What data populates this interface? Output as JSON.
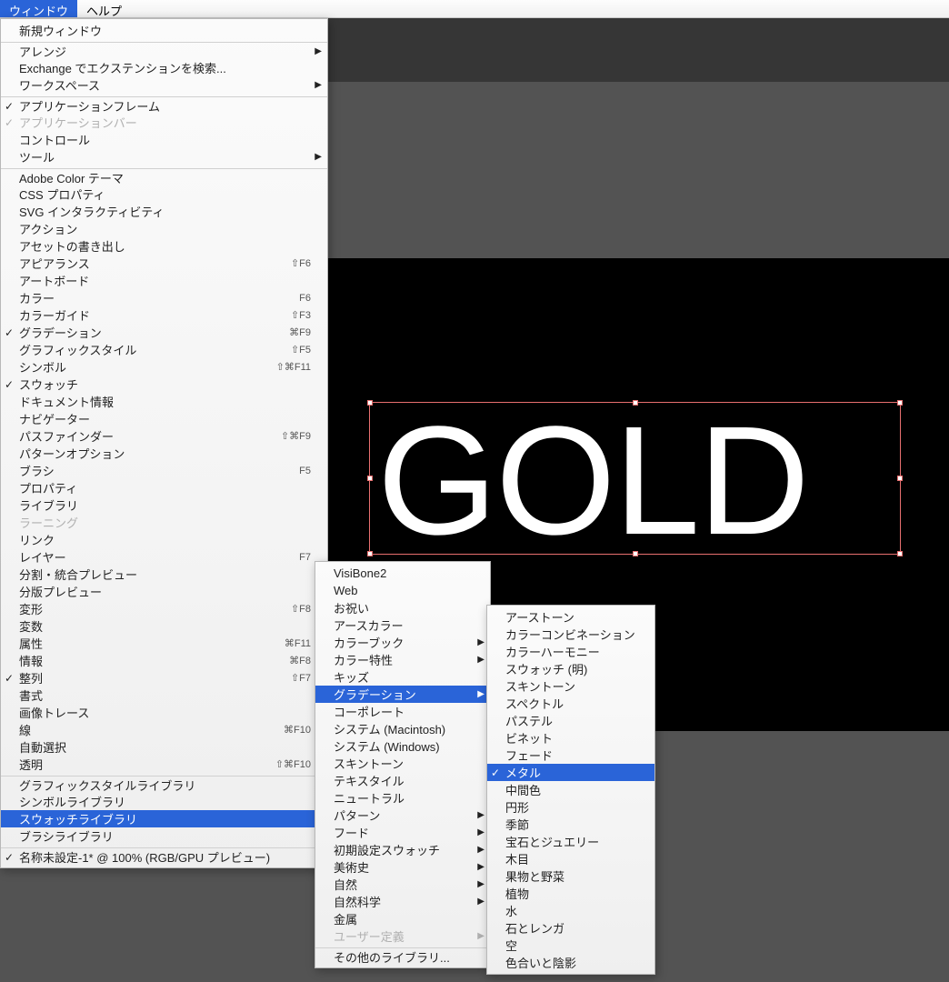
{
  "menubar": {
    "window": "ウィンドウ",
    "help": "ヘルプ"
  },
  "canvas": {
    "text": "GOLD"
  },
  "menu1": [
    {
      "t": "新規ウィンドウ"
    },
    {
      "t": "アレンジ",
      "sep": true,
      "sub": true
    },
    {
      "t": "Exchange でエクステンションを検索..."
    },
    {
      "t": "ワークスペース",
      "sub": true
    },
    {
      "t": "アプリケーションフレーム",
      "sep": true,
      "chk": true
    },
    {
      "t": "アプリケーションバー",
      "chk": true,
      "dis": true
    },
    {
      "t": "コントロール"
    },
    {
      "t": "ツール",
      "sub": true
    },
    {
      "t": "Adobe Color テーマ",
      "sep": true
    },
    {
      "t": "CSS プロパティ"
    },
    {
      "t": "SVG インタラクティビティ"
    },
    {
      "t": "アクション"
    },
    {
      "t": "アセットの書き出し"
    },
    {
      "t": "アピアランス",
      "sc": "⇧F6"
    },
    {
      "t": "アートボード"
    },
    {
      "t": "カラー",
      "sc": "F6"
    },
    {
      "t": "カラーガイド",
      "sc": "⇧F3"
    },
    {
      "t": "グラデーション",
      "chk": true,
      "sc": "⌘F9"
    },
    {
      "t": "グラフィックスタイル",
      "sc": "⇧F5"
    },
    {
      "t": "シンボル",
      "sc": "⇧⌘F11"
    },
    {
      "t": "スウォッチ",
      "chk": true
    },
    {
      "t": "ドキュメント情報"
    },
    {
      "t": "ナビゲーター"
    },
    {
      "t": "パスファインダー",
      "sc": "⇧⌘F9"
    },
    {
      "t": "パターンオプション"
    },
    {
      "t": "ブラシ",
      "sc": "F5"
    },
    {
      "t": "プロパティ"
    },
    {
      "t": "ライブラリ"
    },
    {
      "t": "ラーニング",
      "dis": true
    },
    {
      "t": "リンク"
    },
    {
      "t": "レイヤー",
      "sc": "F7"
    },
    {
      "t": "分割・統合プレビュー"
    },
    {
      "t": "分版プレビュー"
    },
    {
      "t": "変形",
      "sc": "⇧F8"
    },
    {
      "t": "変数"
    },
    {
      "t": "属性",
      "sc": "⌘F11"
    },
    {
      "t": "情報",
      "sc": "⌘F8"
    },
    {
      "t": "整列",
      "chk": true,
      "sc": "⇧F7"
    },
    {
      "t": "書式",
      "sub": true
    },
    {
      "t": "画像トレース"
    },
    {
      "t": "線",
      "sc": "⌘F10"
    },
    {
      "t": "自動選択"
    },
    {
      "t": "透明",
      "sc": "⇧⌘F10"
    },
    {
      "t": "グラフィックスタイルライブラリ",
      "sep": true,
      "sub": true
    },
    {
      "t": "シンボルライブラリ",
      "sub": true
    },
    {
      "t": "スウォッチライブラリ",
      "sub": true,
      "hl": true
    },
    {
      "t": "ブラシライブラリ",
      "sub": true
    },
    {
      "t": "名称未設定-1* @ 100% (RGB/GPU プレビュー)",
      "sep": true,
      "chk": true
    }
  ],
  "menu2": [
    {
      "t": "VisiBone2"
    },
    {
      "t": "Web"
    },
    {
      "t": "お祝い"
    },
    {
      "t": "アースカラー"
    },
    {
      "t": "カラーブック",
      "sub": true
    },
    {
      "t": "カラー特性",
      "sub": true
    },
    {
      "t": "キッズ"
    },
    {
      "t": "グラデーション",
      "sub": true,
      "hl": true
    },
    {
      "t": "コーポレート"
    },
    {
      "t": "システム (Macintosh)"
    },
    {
      "t": "システム (Windows)"
    },
    {
      "t": "スキントーン"
    },
    {
      "t": "テキスタイル"
    },
    {
      "t": "ニュートラル"
    },
    {
      "t": "パターン",
      "sub": true
    },
    {
      "t": "フード",
      "sub": true
    },
    {
      "t": "初期設定スウォッチ",
      "sub": true
    },
    {
      "t": "美術史",
      "sub": true
    },
    {
      "t": "自然",
      "sub": true
    },
    {
      "t": "自然科学",
      "sub": true
    },
    {
      "t": "金属"
    },
    {
      "t": "ユーザー定義",
      "sub": true,
      "dis": true
    },
    {
      "t": "その他のライブラリ...",
      "sep": true
    }
  ],
  "menu3": [
    {
      "t": "アーストーン"
    },
    {
      "t": "カラーコンビネーション"
    },
    {
      "t": "カラーハーモニー"
    },
    {
      "t": "スウォッチ (明)"
    },
    {
      "t": "スキントーン"
    },
    {
      "t": "スペクトル"
    },
    {
      "t": "パステル"
    },
    {
      "t": "ビネット"
    },
    {
      "t": "フェード"
    },
    {
      "t": "メタル",
      "chk": true,
      "hl": true
    },
    {
      "t": "中間色"
    },
    {
      "t": "円形"
    },
    {
      "t": "季節"
    },
    {
      "t": "宝石とジュエリー"
    },
    {
      "t": "木目"
    },
    {
      "t": "果物と野菜"
    },
    {
      "t": "植物"
    },
    {
      "t": "水"
    },
    {
      "t": "石とレンガ"
    },
    {
      "t": "空"
    },
    {
      "t": "色合いと陰影"
    }
  ]
}
